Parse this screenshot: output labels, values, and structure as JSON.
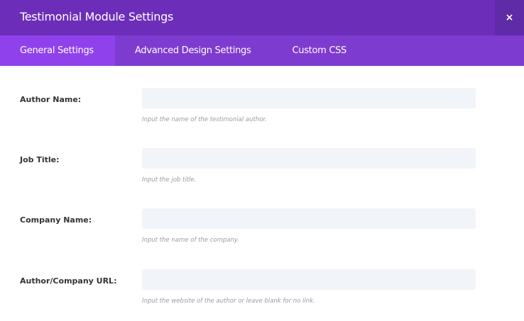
{
  "header": {
    "title": "Testimonial Module Settings",
    "close_icon": "×"
  },
  "tabs": [
    {
      "label": "General Settings",
      "active": true
    },
    {
      "label": "Advanced Design Settings",
      "active": false
    },
    {
      "label": "Custom CSS",
      "active": false
    }
  ],
  "fields": [
    {
      "label": "Author Name:",
      "value": "",
      "help": "Input the name of the testimonial author."
    },
    {
      "label": "Job Title:",
      "value": "",
      "help": "Input the job title."
    },
    {
      "label": "Company Name:",
      "value": "",
      "help": "Input the name of the company."
    },
    {
      "label": "Author/Company URL:",
      "value": "",
      "help": "Input the website of the author or leave blank for no link."
    }
  ],
  "colors": {
    "header": "#6c2eb9",
    "tab_bar": "#7e3bd0",
    "active_tab": "#8f42ec"
  }
}
